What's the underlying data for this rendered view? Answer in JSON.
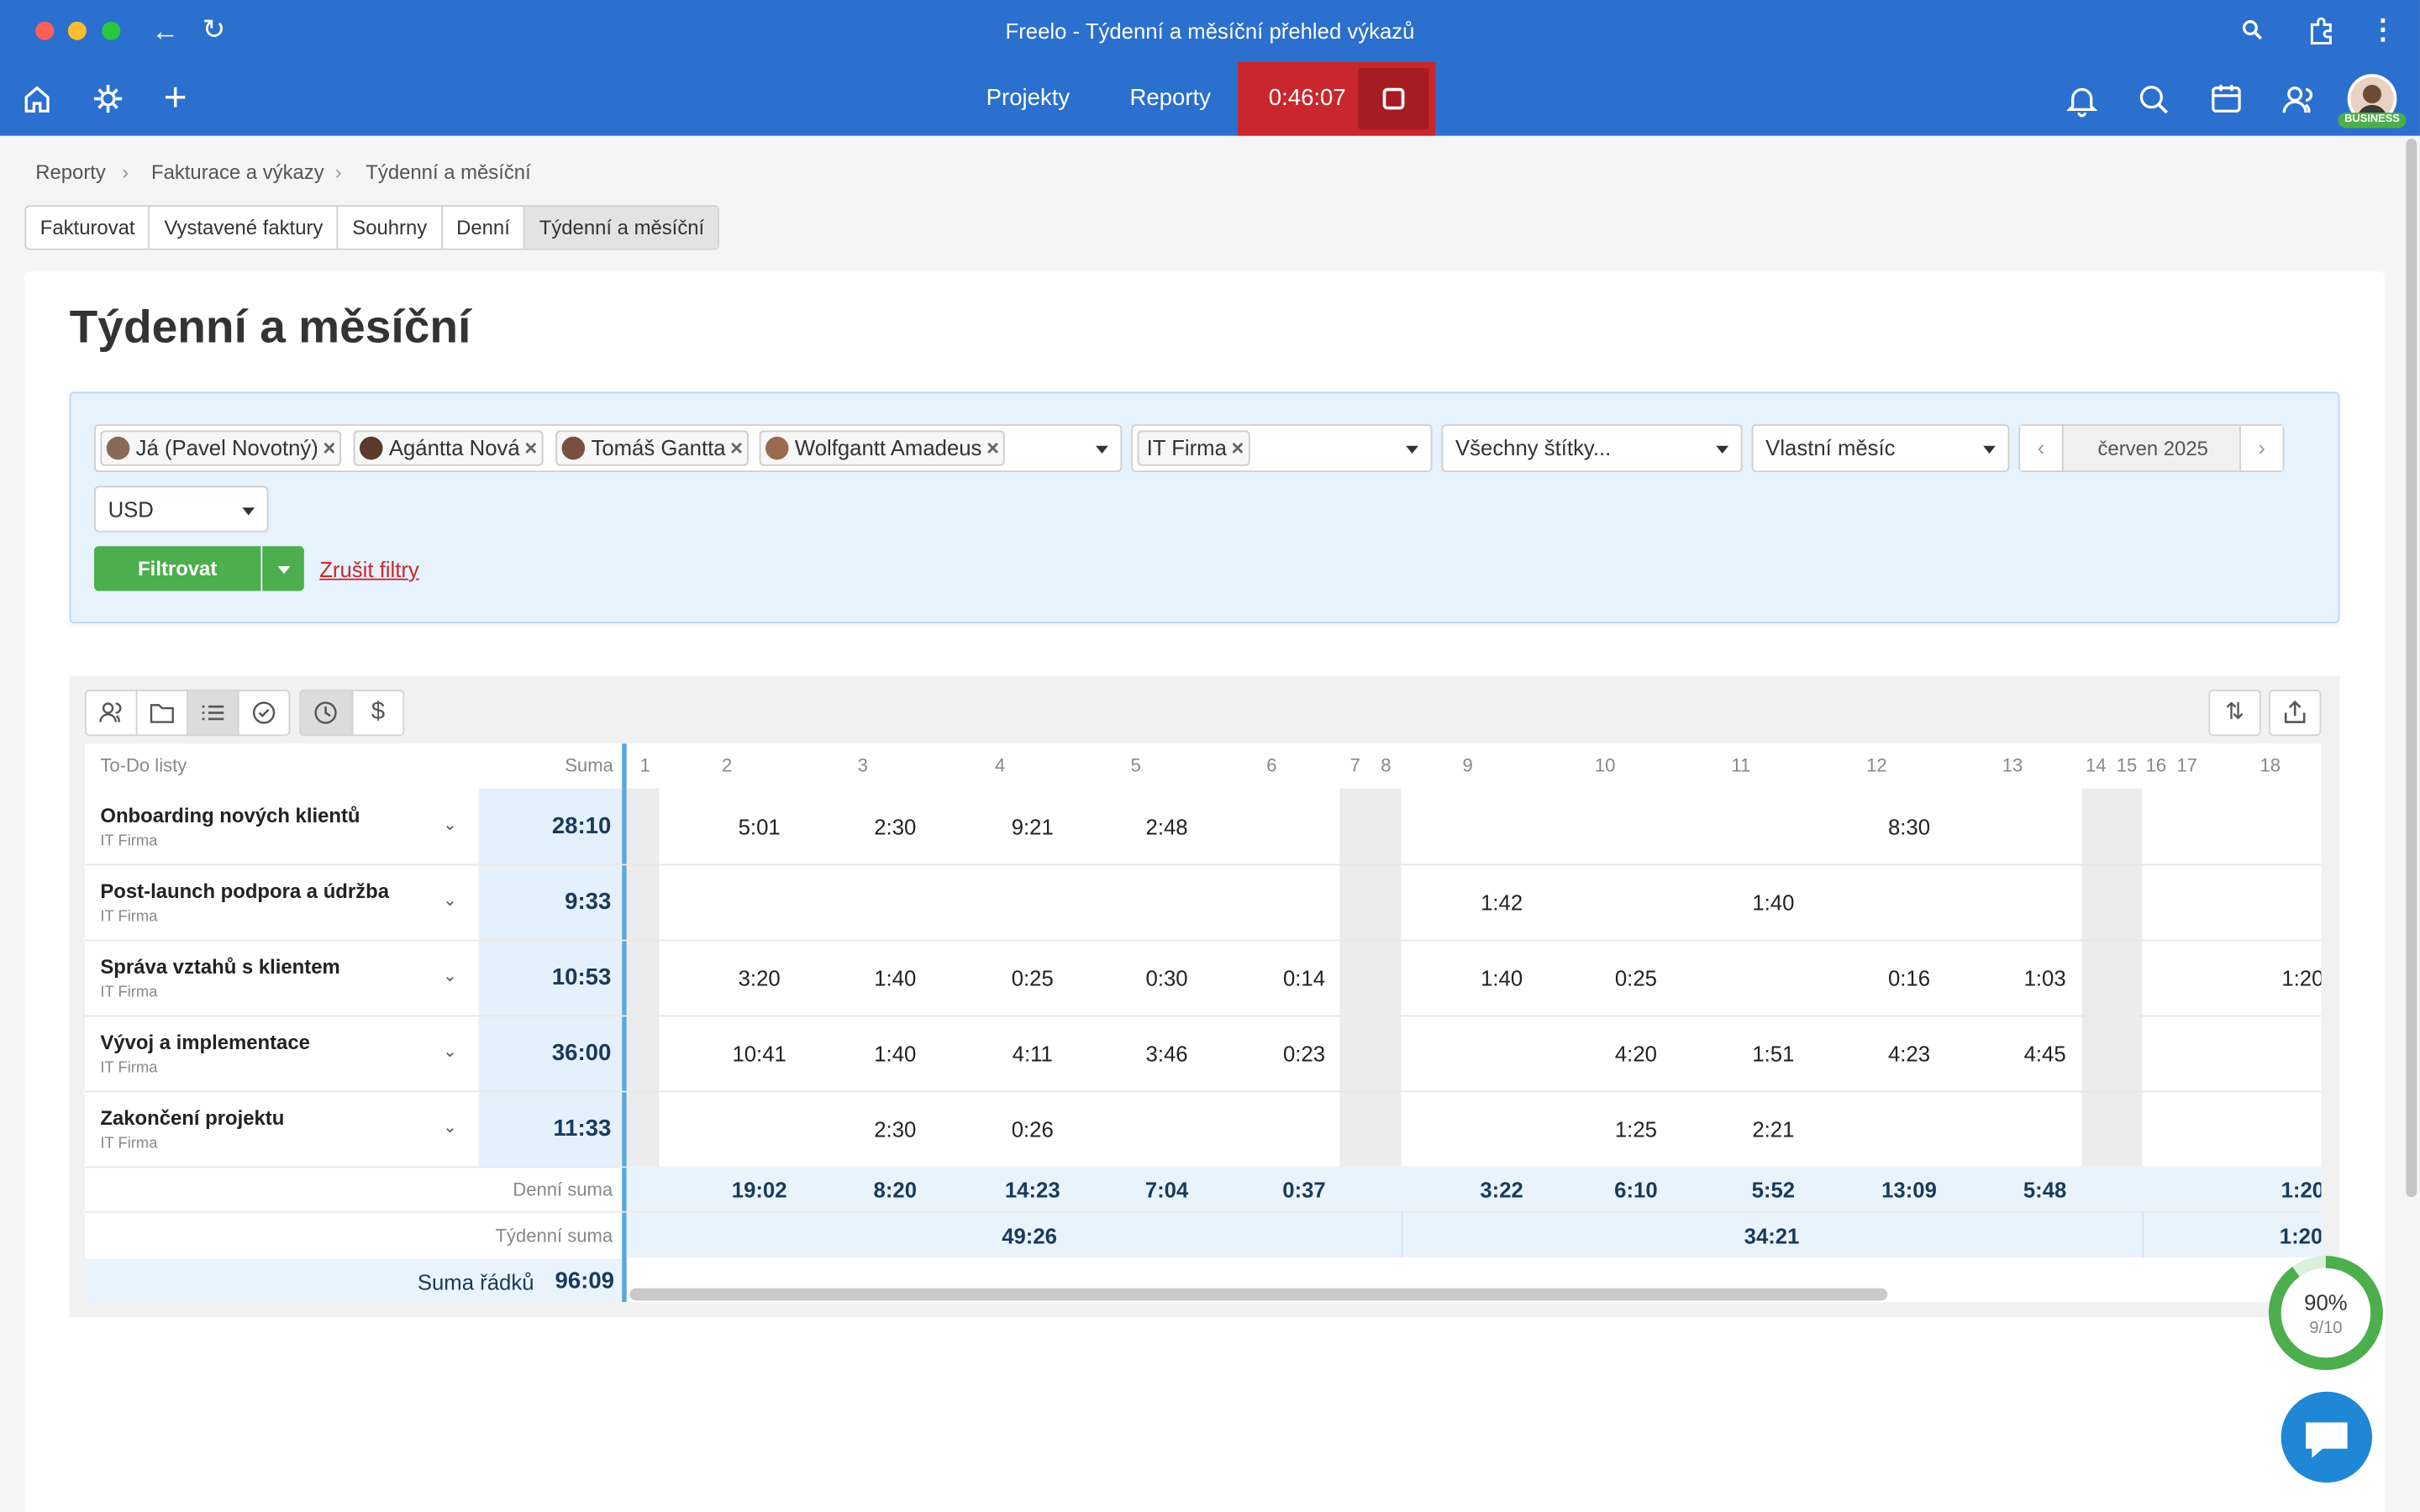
{
  "window": {
    "title": "Freelo - Týdenní a měsíční přehled výkazů"
  },
  "nav": {
    "projects": "Projekty",
    "reports": "Reporty",
    "timer": "0:46:07",
    "plan_badge": "BUSINESS"
  },
  "breadcrumb": [
    "Reporty",
    "Fakturace a výkazy",
    "Týdenní a měsíční"
  ],
  "tabs": [
    "Fakturovat",
    "Vystavené faktury",
    "Souhrny",
    "Denní",
    "Týdenní a měsíční"
  ],
  "page_title": "Týdenní a měsíční",
  "filters": {
    "users": [
      "Já (Pavel Novotný)",
      "Agántta Nová",
      "Tomáš Gantta",
      "Wolfgantt Amadeus"
    ],
    "client": "IT Firma",
    "tags": "Všechny štítky...",
    "period": "Vlastní měsíc",
    "month": "červen 2025",
    "currency": "USD",
    "filter_button": "Filtrovat",
    "clear_filters": "Zrušit filtry"
  },
  "table": {
    "col_todo": "To-Do listy",
    "col_sum": "Suma",
    "days": [
      "1",
      "2",
      "3",
      "4",
      "5",
      "6",
      "7",
      "8",
      "9",
      "10",
      "11",
      "12",
      "13",
      "14",
      "15",
      "16",
      "17",
      "18"
    ],
    "rows": [
      {
        "name": "Onboarding nových klientů",
        "client": "IT Firma",
        "sum": "28:10",
        "values": [
          "",
          "5:01",
          "2:30",
          "9:21",
          "2:48",
          "",
          "",
          "",
          "",
          "",
          "",
          "8:30",
          "",
          "",
          "",
          "",
          "",
          ""
        ]
      },
      {
        "name": "Post-launch podpora a údržba",
        "client": "IT Firma",
        "sum": "9:33",
        "values": [
          "",
          "",
          "",
          "",
          "",
          "",
          "",
          "",
          "1:42",
          "",
          "1:40",
          "",
          "",
          "",
          "",
          "",
          "",
          ""
        ]
      },
      {
        "name": "Správa vztahů s klientem",
        "client": "IT Firma",
        "sum": "10:53",
        "values": [
          "",
          "3:20",
          "1:40",
          "0:25",
          "0:30",
          "0:14",
          "",
          "",
          "1:40",
          "0:25",
          "",
          "0:16",
          "1:03",
          "",
          "",
          "",
          "",
          "1:20"
        ]
      },
      {
        "name": "Vývoj a implementace",
        "client": "IT Firma",
        "sum": "36:00",
        "values": [
          "",
          "10:41",
          "1:40",
          "4:11",
          "3:46",
          "0:23",
          "",
          "",
          "",
          "4:20",
          "1:51",
          "4:23",
          "4:45",
          "",
          "",
          "",
          "",
          ""
        ]
      },
      {
        "name": "Zakončení projektu",
        "client": "IT Firma",
        "sum": "11:33",
        "values": [
          "",
          "",
          "2:30",
          "0:26",
          "",
          "",
          "",
          "",
          "",
          "1:25",
          "2:21",
          "",
          "",
          "",
          "",
          "",
          "",
          ""
        ]
      }
    ],
    "daily_label": "Denní suma",
    "daily": [
      "",
      "19:02",
      "8:20",
      "14:23",
      "7:04",
      "0:37",
      "",
      "",
      "3:22",
      "6:10",
      "5:52",
      "13:09",
      "5:48",
      "",
      "",
      "",
      "",
      "1:20"
    ],
    "weekly_label": "Týdenní suma",
    "weekly": [
      "49:26",
      "34:21",
      "1:20"
    ],
    "rows_sum_label": "Suma řádků",
    "rows_sum": "96:09"
  },
  "progress": {
    "percent": "90%",
    "count": "9/10",
    "value": 0.9
  }
}
